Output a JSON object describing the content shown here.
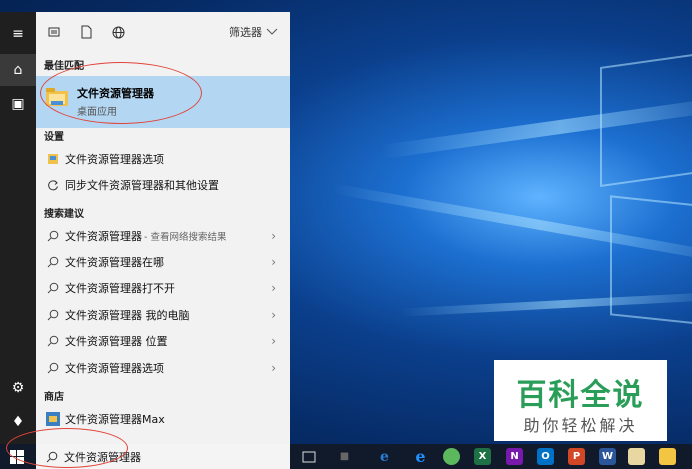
{
  "toolbar": {
    "filter_label": "筛选器"
  },
  "best_match": {
    "heading": "最佳匹配",
    "title": "文件资源管理器",
    "subtitle": "桌面应用"
  },
  "settings": {
    "heading": "设置",
    "items": [
      {
        "label": "文件资源管理器选项",
        "icon": "folder-options-icon"
      },
      {
        "label": "同步文件资源管理器和其他设置",
        "icon": "sync-icon"
      }
    ]
  },
  "suggestions": {
    "heading": "搜索建议",
    "items": [
      {
        "label": "文件资源管理器",
        "sub": " - 查看网络搜索结果"
      },
      {
        "label": "文件资源管理器在哪",
        "sub": ""
      },
      {
        "label": "文件资源管理器打不开",
        "sub": ""
      },
      {
        "label": "文件资源管理器 我的电脑",
        "sub": ""
      },
      {
        "label": "文件资源管理器 位置",
        "sub": ""
      },
      {
        "label": "文件资源管理器选项",
        "sub": ""
      }
    ]
  },
  "store": {
    "heading": "商店",
    "item_label": "文件资源管理器Max"
  },
  "search": {
    "query": "文件资源管理器"
  },
  "taskbar": {
    "apps": [
      {
        "name": "task-view-icon",
        "letter": "",
        "color": ""
      },
      {
        "name": "people-icon",
        "letter": "",
        "color": ""
      },
      {
        "name": "edge-icon-1",
        "letter": "e",
        "color": "#1a7fd4"
      },
      {
        "name": "edge-icon-2",
        "letter": "e",
        "color": "#1e90ff"
      },
      {
        "name": "media-icon",
        "letter": "",
        "color": "#5cb85c"
      },
      {
        "name": "excel-icon",
        "letter": "X",
        "color": "#1e7145"
      },
      {
        "name": "onenote-icon",
        "letter": "N",
        "color": "#7719aa"
      },
      {
        "name": "outlook-icon",
        "letter": "O",
        "color": "#0072c6"
      },
      {
        "name": "powerpoint-icon",
        "letter": "P",
        "color": "#d24726"
      },
      {
        "name": "word-icon",
        "letter": "W",
        "color": "#2b579a"
      },
      {
        "name": "paint-icon",
        "letter": "",
        "color": "#e8d7a0"
      },
      {
        "name": "file-explorer-icon",
        "letter": "",
        "color": "#f4c542"
      }
    ]
  },
  "watermark": {
    "big": "百科全说",
    "small": "助你轻松解决"
  },
  "colors": {
    "highlight": "#b3d7f3",
    "annotation": "#e0443a",
    "watermark": "#2a9d58"
  }
}
